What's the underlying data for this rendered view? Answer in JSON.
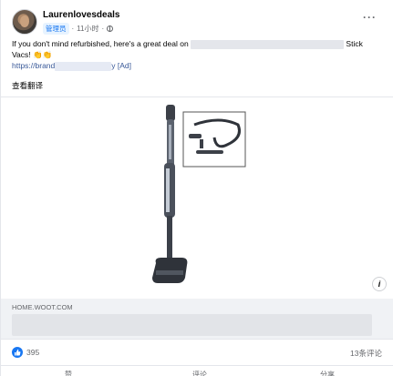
{
  "post": {
    "author": "Laurenlovesdeals",
    "role_badge": "管理员",
    "time": "11小时",
    "text_prefix": "If you don't mind refurbished, here's a great deal on",
    "text_suffix": "Stick",
    "text_line2": "Vacs! 👏👏",
    "link_text": "https://brand",
    "link_suffix": "y [Ad]",
    "see_translation": "查看翻译"
  },
  "preview": {
    "domain": "HOME.WOOT.COM"
  },
  "stats": {
    "likes": "395",
    "comments": "13条评论"
  },
  "actions": [
    {
      "label": "赞"
    },
    {
      "label": "评论"
    },
    {
      "label": "分享"
    }
  ],
  "colors": {
    "accent": "#1877f2",
    "secondary_text": "#65676b",
    "link": "#385898"
  }
}
